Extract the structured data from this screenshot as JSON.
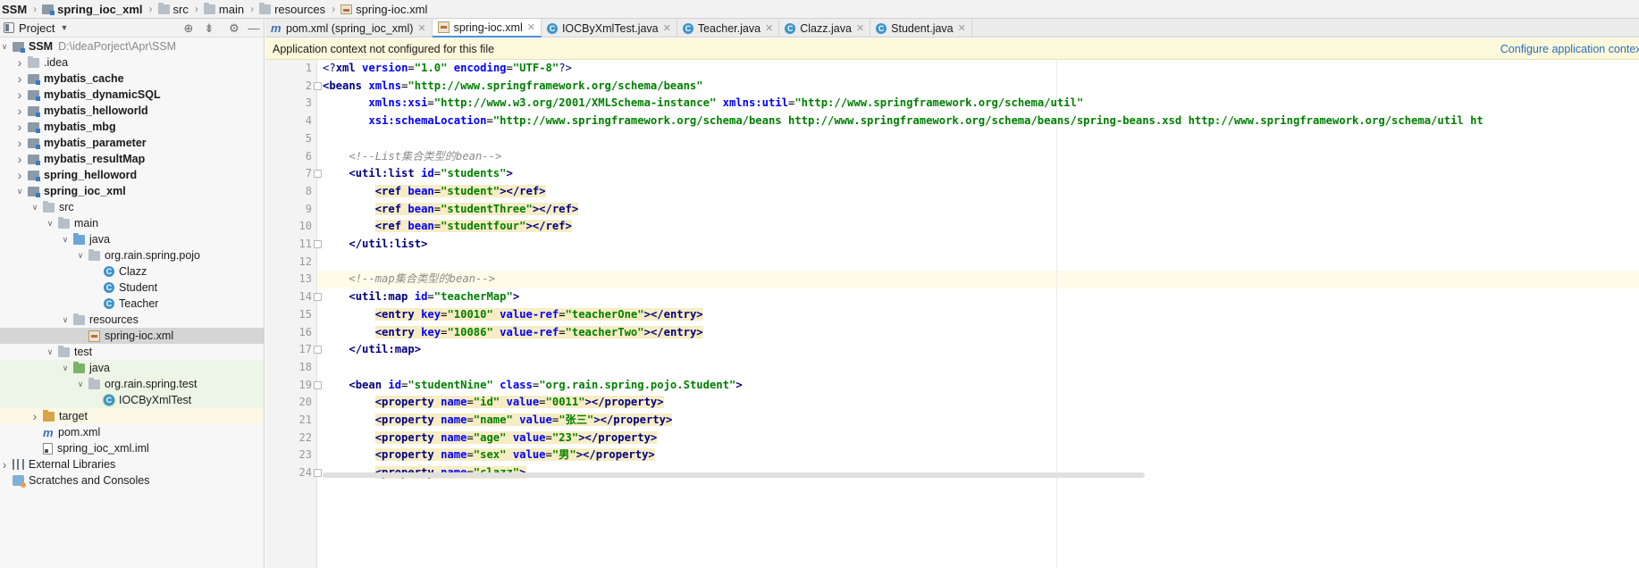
{
  "breadcrumbs": [
    {
      "label": "SSM",
      "bold": true,
      "icon": "none"
    },
    {
      "label": "spring_ioc_xml",
      "bold": true,
      "icon": "module-folder-icon"
    },
    {
      "label": "src",
      "bold": false,
      "icon": "folder-icon"
    },
    {
      "label": "main",
      "bold": false,
      "icon": "folder-icon"
    },
    {
      "label": "resources",
      "bold": false,
      "icon": "resources-folder-icon"
    },
    {
      "label": "spring-ioc.xml",
      "bold": false,
      "icon": "xml-file-icon"
    }
  ],
  "project_panel": {
    "title": "Project",
    "tree": [
      {
        "label": "SSM",
        "path": "D:\\ideaPorject\\Apr\\SSM",
        "bold": true,
        "depth": 0,
        "arrow": "down",
        "icon": "module"
      },
      {
        "label": ".idea",
        "bold": false,
        "depth": 1,
        "arrow": "right",
        "icon": "folder"
      },
      {
        "label": "mybatis_cache",
        "bold": true,
        "depth": 1,
        "arrow": "right",
        "icon": "module"
      },
      {
        "label": "mybatis_dynamicSQL",
        "bold": true,
        "depth": 1,
        "arrow": "right",
        "icon": "module"
      },
      {
        "label": "mybatis_helloworld",
        "bold": true,
        "depth": 1,
        "arrow": "right",
        "icon": "module"
      },
      {
        "label": "mybatis_mbg",
        "bold": true,
        "depth": 1,
        "arrow": "right",
        "icon": "module"
      },
      {
        "label": "mybatis_parameter",
        "bold": true,
        "depth": 1,
        "arrow": "right",
        "icon": "module"
      },
      {
        "label": "mybatis_resultMap",
        "bold": true,
        "depth": 1,
        "arrow": "right",
        "icon": "module"
      },
      {
        "label": "spring_helloword",
        "bold": true,
        "depth": 1,
        "arrow": "right",
        "icon": "module"
      },
      {
        "label": "spring_ioc_xml",
        "bold": true,
        "depth": 1,
        "arrow": "down",
        "icon": "module"
      },
      {
        "label": "src",
        "bold": false,
        "depth": 2,
        "arrow": "down",
        "icon": "folder"
      },
      {
        "label": "main",
        "bold": false,
        "depth": 3,
        "arrow": "down",
        "icon": "folder"
      },
      {
        "label": "java",
        "bold": false,
        "depth": 4,
        "arrow": "down",
        "icon": "src"
      },
      {
        "label": "org.rain.spring.pojo",
        "bold": false,
        "depth": 5,
        "arrow": "down",
        "icon": "package"
      },
      {
        "label": "Clazz",
        "bold": false,
        "depth": 6,
        "arrow": "none",
        "icon": "class"
      },
      {
        "label": "Student",
        "bold": false,
        "depth": 6,
        "arrow": "none",
        "icon": "class"
      },
      {
        "label": "Teacher",
        "bold": false,
        "depth": 6,
        "arrow": "none",
        "icon": "class"
      },
      {
        "label": "resources",
        "bold": false,
        "depth": 4,
        "arrow": "down",
        "icon": "resources"
      },
      {
        "label": "spring-ioc.xml",
        "bold": false,
        "depth": 5,
        "arrow": "none",
        "icon": "xml",
        "state": "selected"
      },
      {
        "label": "test",
        "bold": false,
        "depth": 3,
        "arrow": "down",
        "icon": "folder"
      },
      {
        "label": "java",
        "bold": false,
        "depth": 4,
        "arrow": "down",
        "icon": "test",
        "state": "test"
      },
      {
        "label": "org.rain.spring.test",
        "bold": false,
        "depth": 5,
        "arrow": "down",
        "icon": "package",
        "state": "test"
      },
      {
        "label": "IOCByXmlTest",
        "bold": false,
        "depth": 6,
        "arrow": "none",
        "icon": "testclass",
        "state": "test"
      },
      {
        "label": "target",
        "bold": false,
        "depth": 2,
        "arrow": "right",
        "icon": "excluded",
        "state": "excluded"
      },
      {
        "label": "pom.xml",
        "bold": false,
        "depth": 2,
        "arrow": "none",
        "icon": "maven"
      },
      {
        "label": "spring_ioc_xml.iml",
        "bold": false,
        "depth": 2,
        "arrow": "none",
        "icon": "iml"
      },
      {
        "label": "External Libraries",
        "bold": false,
        "depth": 0,
        "arrow": "right",
        "icon": "library"
      },
      {
        "label": "Scratches and Consoles",
        "bold": false,
        "depth": 0,
        "arrow": "none",
        "icon": "scratch"
      }
    ]
  },
  "tabs": [
    {
      "label": "pom.xml (spring_ioc_xml)",
      "icon": "maven",
      "active": false
    },
    {
      "label": "spring-ioc.xml",
      "icon": "xml",
      "active": true
    },
    {
      "label": "IOCByXmlTest.java",
      "icon": "class",
      "active": false
    },
    {
      "label": "Teacher.java",
      "icon": "class",
      "active": false
    },
    {
      "label": "Clazz.java",
      "icon": "class",
      "active": false
    },
    {
      "label": "Student.java",
      "icon": "class",
      "active": false
    }
  ],
  "notice": {
    "message": "Application context not configured for this file",
    "action": "Configure application context"
  },
  "editor": {
    "current_line": 13,
    "lines": [
      {
        "n": "1",
        "fold": false,
        "tokens": [
          [
            "pi",
            "<?"
          ],
          [
            "t",
            "xml "
          ],
          [
            "a",
            "version"
          ],
          [
            "p",
            "="
          ],
          [
            "v",
            "\"1.0\""
          ],
          [
            "p",
            " "
          ],
          [
            "a",
            "encoding"
          ],
          [
            "p",
            "="
          ],
          [
            "v",
            "\"UTF-8\""
          ],
          [
            "pi",
            "?>"
          ]
        ]
      },
      {
        "n": "2",
        "fold": true,
        "tokens": [
          [
            "t",
            "<beans "
          ],
          [
            "a",
            "xmlns"
          ],
          [
            "p",
            "="
          ],
          [
            "v",
            "\"http://www.springframework.org/schema/beans\""
          ]
        ]
      },
      {
        "n": "3",
        "fold": false,
        "tokens": [
          [
            "p",
            "       "
          ],
          [
            "a",
            "xmlns:xsi"
          ],
          [
            "p",
            "="
          ],
          [
            "v",
            "\"http://www.w3.org/2001/XMLSchema-instance\""
          ],
          [
            "p",
            " "
          ],
          [
            "a",
            "xmlns:util"
          ],
          [
            "p",
            "="
          ],
          [
            "v",
            "\"http://www.springframework.org/schema/util\""
          ]
        ]
      },
      {
        "n": "4",
        "fold": false,
        "tokens": [
          [
            "p",
            "       "
          ],
          [
            "a",
            "xsi:schemaLocation"
          ],
          [
            "p",
            "="
          ],
          [
            "v",
            "\"http://www.springframework.org/schema/beans http://www.springframework.org/schema/beans/spring-beans.xsd http://www.springframework.org/schema/util ht"
          ]
        ]
      },
      {
        "n": "5",
        "fold": false,
        "tokens": []
      },
      {
        "n": "6",
        "fold": false,
        "tokens": [
          [
            "p",
            "    "
          ],
          [
            "cm",
            "<!--List集合类型的bean-->"
          ]
        ]
      },
      {
        "n": "7",
        "fold": true,
        "tokens": [
          [
            "p",
            "    "
          ],
          [
            "t",
            "<util:list "
          ],
          [
            "a",
            "id"
          ],
          [
            "p",
            "="
          ],
          [
            "v",
            "\"students\""
          ],
          [
            "t",
            ">"
          ]
        ]
      },
      {
        "n": "8",
        "fold": false,
        "bg": true,
        "tokens": [
          [
            "p",
            "        "
          ],
          [
            "t",
            "<ref "
          ],
          [
            "a",
            "bean"
          ],
          [
            "p",
            "="
          ],
          [
            "v",
            "\"student\""
          ],
          [
            "t",
            "></ref>"
          ]
        ]
      },
      {
        "n": "9",
        "fold": false,
        "bg": true,
        "tokens": [
          [
            "p",
            "        "
          ],
          [
            "t",
            "<ref "
          ],
          [
            "a",
            "bean"
          ],
          [
            "p",
            "="
          ],
          [
            "v",
            "\"studentThree\""
          ],
          [
            "t",
            "></ref>"
          ]
        ]
      },
      {
        "n": "10",
        "fold": false,
        "bg": true,
        "tokens": [
          [
            "p",
            "        "
          ],
          [
            "t",
            "<ref "
          ],
          [
            "a",
            "bean"
          ],
          [
            "p",
            "="
          ],
          [
            "v",
            "\"studentfour\""
          ],
          [
            "t",
            "></ref>"
          ]
        ]
      },
      {
        "n": "11",
        "fold": true,
        "tokens": [
          [
            "p",
            "    "
          ],
          [
            "t",
            "</util:list>"
          ]
        ]
      },
      {
        "n": "12",
        "fold": false,
        "tokens": []
      },
      {
        "n": "13",
        "fold": false,
        "tokens": [
          [
            "p",
            "    "
          ],
          [
            "cm",
            "<!--map集合类型的bean-->"
          ]
        ]
      },
      {
        "n": "14",
        "fold": true,
        "tokens": [
          [
            "p",
            "    "
          ],
          [
            "t",
            "<util:map "
          ],
          [
            "a",
            "id"
          ],
          [
            "p",
            "="
          ],
          [
            "v",
            "\"teacherMap\""
          ],
          [
            "t",
            ">"
          ]
        ]
      },
      {
        "n": "15",
        "fold": false,
        "bg": true,
        "tokens": [
          [
            "p",
            "        "
          ],
          [
            "t",
            "<entry "
          ],
          [
            "a",
            "key"
          ],
          [
            "p",
            "="
          ],
          [
            "v",
            "\"10010\""
          ],
          [
            "p",
            " "
          ],
          [
            "a",
            "value-ref"
          ],
          [
            "p",
            "="
          ],
          [
            "v",
            "\"teacherOne\""
          ],
          [
            "t",
            "></entry>"
          ]
        ]
      },
      {
        "n": "16",
        "fold": false,
        "bg": true,
        "tokens": [
          [
            "p",
            "        "
          ],
          [
            "t",
            "<entry "
          ],
          [
            "a",
            "key"
          ],
          [
            "p",
            "="
          ],
          [
            "v",
            "\"10086\""
          ],
          [
            "p",
            " "
          ],
          [
            "a",
            "value-ref"
          ],
          [
            "p",
            "="
          ],
          [
            "v",
            "\"teacherTwo\""
          ],
          [
            "t",
            "></entry>"
          ]
        ]
      },
      {
        "n": "17",
        "fold": true,
        "tokens": [
          [
            "p",
            "    "
          ],
          [
            "t",
            "</util:map>"
          ]
        ]
      },
      {
        "n": "18",
        "fold": false,
        "tokens": []
      },
      {
        "n": "19",
        "fold": true,
        "tokens": [
          [
            "p",
            "    "
          ],
          [
            "t",
            "<bean "
          ],
          [
            "a",
            "id"
          ],
          [
            "p",
            "="
          ],
          [
            "v",
            "\"studentNine\""
          ],
          [
            "p",
            " "
          ],
          [
            "a",
            "class"
          ],
          [
            "p",
            "="
          ],
          [
            "v",
            "\"org.rain.spring.pojo.Student\""
          ],
          [
            "t",
            ">"
          ]
        ]
      },
      {
        "n": "20",
        "fold": false,
        "bg": true,
        "tokens": [
          [
            "p",
            "        "
          ],
          [
            "t",
            "<property "
          ],
          [
            "a",
            "name"
          ],
          [
            "p",
            "="
          ],
          [
            "v",
            "\"id\""
          ],
          [
            "p",
            " "
          ],
          [
            "a",
            "value"
          ],
          [
            "p",
            "="
          ],
          [
            "v",
            "\"0011\""
          ],
          [
            "t",
            "></property>"
          ]
        ]
      },
      {
        "n": "21",
        "fold": false,
        "bg": true,
        "tokens": [
          [
            "p",
            "        "
          ],
          [
            "t",
            "<property "
          ],
          [
            "a",
            "name"
          ],
          [
            "p",
            "="
          ],
          [
            "v",
            "\"name\""
          ],
          [
            "p",
            " "
          ],
          [
            "a",
            "value"
          ],
          [
            "p",
            "="
          ],
          [
            "v",
            "\"张三\""
          ],
          [
            "t",
            "></property>"
          ]
        ]
      },
      {
        "n": "22",
        "fold": false,
        "bg": true,
        "tokens": [
          [
            "p",
            "        "
          ],
          [
            "t",
            "<property "
          ],
          [
            "a",
            "name"
          ],
          [
            "p",
            "="
          ],
          [
            "v",
            "\"age\""
          ],
          [
            "p",
            " "
          ],
          [
            "a",
            "value"
          ],
          [
            "p",
            "="
          ],
          [
            "v",
            "\"23\""
          ],
          [
            "t",
            "></property>"
          ]
        ]
      },
      {
        "n": "23",
        "fold": false,
        "bg": true,
        "tokens": [
          [
            "p",
            "        "
          ],
          [
            "t",
            "<property "
          ],
          [
            "a",
            "name"
          ],
          [
            "p",
            "="
          ],
          [
            "v",
            "\"sex\""
          ],
          [
            "p",
            " "
          ],
          [
            "a",
            "value"
          ],
          [
            "p",
            "="
          ],
          [
            "v",
            "\"男\""
          ],
          [
            "t",
            "></property>"
          ]
        ]
      },
      {
        "n": "24",
        "fold": true,
        "bg": true,
        "tokens": [
          [
            "p",
            "        "
          ],
          [
            "t",
            "<property "
          ],
          [
            "a",
            "name"
          ],
          [
            "p",
            "="
          ],
          [
            "v",
            "\"clazz\""
          ],
          [
            "t",
            ">"
          ]
        ]
      }
    ]
  }
}
